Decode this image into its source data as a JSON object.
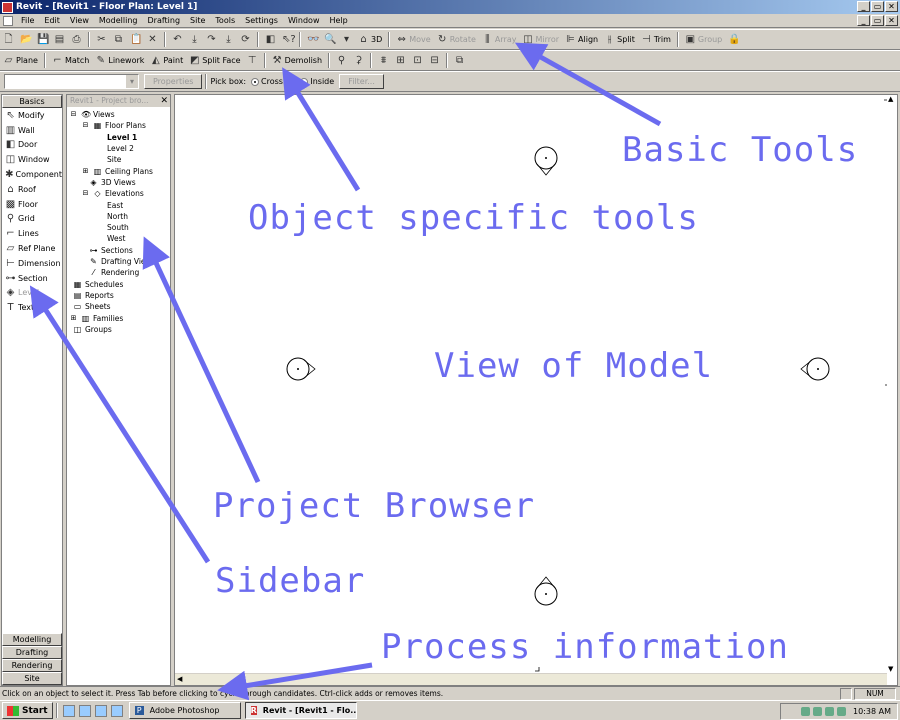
{
  "window": {
    "title": "Revit - [Revit1 - Floor Plan: Level 1]",
    "min": "_",
    "max": "▭",
    "close": "✕"
  },
  "menu": [
    "File",
    "Edit",
    "View",
    "Modelling",
    "Drafting",
    "Site",
    "Tools",
    "Settings",
    "Window",
    "Help"
  ],
  "toolbar1": {
    "view_3d": "3D",
    "basic_tools": [
      {
        "label": "Move",
        "disabled": true
      },
      {
        "label": "Rotate",
        "disabled": true
      },
      {
        "label": "Array",
        "disabled": true
      },
      {
        "label": "Mirror",
        "disabled": true
      },
      {
        "label": "Align",
        "disabled": false
      },
      {
        "label": "Split",
        "disabled": false
      },
      {
        "label": "Trim",
        "disabled": false
      },
      {
        "label": "Group",
        "disabled": true
      }
    ]
  },
  "toolbar2": [
    "Plane",
    "Match",
    "Linework",
    "Paint",
    "Split Face",
    "Demolish"
  ],
  "options_bar": {
    "properties": "Properties",
    "pick_box": "Pick box:",
    "crossing": "Crossing",
    "inside": "Inside",
    "filter": "Filter..."
  },
  "sidebar": {
    "tab": "Basics",
    "items": [
      {
        "label": "Modify",
        "icon": "cursor-icon",
        "glyph": "⇖",
        "disabled": false
      },
      {
        "label": "Wall",
        "icon": "wall-icon",
        "glyph": "▥",
        "disabled": false
      },
      {
        "label": "Door",
        "icon": "door-icon",
        "glyph": "◧",
        "disabled": false
      },
      {
        "label": "Window",
        "icon": "window-icon",
        "glyph": "◫",
        "disabled": false
      },
      {
        "label": "Component",
        "icon": "component-icon",
        "glyph": "✱",
        "disabled": false
      },
      {
        "label": "Roof",
        "icon": "roof-icon",
        "glyph": "⌂",
        "disabled": false
      },
      {
        "label": "Floor",
        "icon": "floor-icon",
        "glyph": "▩",
        "disabled": false
      },
      {
        "label": "Grid",
        "icon": "grid-icon",
        "glyph": "⚲",
        "disabled": false
      },
      {
        "label": "Lines",
        "icon": "lines-icon",
        "glyph": "⌐",
        "disabled": false
      },
      {
        "label": "Ref Plane",
        "icon": "ref-plane-icon",
        "glyph": "▱",
        "disabled": false
      },
      {
        "label": "Dimension",
        "icon": "dimension-icon",
        "glyph": "⊢",
        "disabled": false
      },
      {
        "label": "Section",
        "icon": "section-icon",
        "glyph": "⊶",
        "disabled": false
      },
      {
        "label": "Level",
        "icon": "level-icon",
        "glyph": "◈",
        "disabled": true
      },
      {
        "label": "Text",
        "icon": "text-icon",
        "glyph": "T",
        "disabled": false
      }
    ],
    "bottom_tabs": [
      "Modelling",
      "Drafting",
      "Rendering",
      "Site"
    ]
  },
  "browser": {
    "title": "Revit1 - Project bro...",
    "close": "✕",
    "tree": [
      {
        "label": "Views",
        "icon": "views-icon",
        "glyph": "👁",
        "expander": "⊟"
      },
      {
        "label": "Floor Plans",
        "icon": "floor-plan-icon",
        "glyph": "▦",
        "expander": "⊟"
      },
      {
        "label": "Level 1",
        "bold": true
      },
      {
        "label": "Level 2"
      },
      {
        "label": "Site"
      },
      {
        "label": "Ceiling Plans",
        "icon": "ceiling-plan-icon",
        "glyph": "▥",
        "expander": "⊞"
      },
      {
        "label": "3D Views",
        "icon": "3d-view-icon",
        "glyph": "◈"
      },
      {
        "label": "Elevations",
        "icon": "elevation-icon",
        "glyph": "◇",
        "expander": "⊟"
      },
      {
        "label": "East"
      },
      {
        "label": "North"
      },
      {
        "label": "South"
      },
      {
        "label": "West"
      },
      {
        "label": "Sections",
        "icon": "sections-icon",
        "glyph": "⊶"
      },
      {
        "label": "Drafting Views",
        "icon": "drafting-icon",
        "glyph": "✎"
      },
      {
        "label": "Rendering",
        "icon": "rendering-icon",
        "glyph": "⁄"
      },
      {
        "label": "Schedules",
        "icon": "schedule-icon",
        "glyph": "▦"
      },
      {
        "label": "Reports",
        "icon": "report-icon",
        "glyph": "▤"
      },
      {
        "label": "Sheets",
        "icon": "sheet-icon",
        "glyph": "▭"
      },
      {
        "label": "Families",
        "icon": "families-icon",
        "glyph": "▥",
        "expander": "⊞"
      },
      {
        "label": "Groups",
        "icon": "groups-icon",
        "glyph": "◫"
      }
    ]
  },
  "status": {
    "message": "Click on an object to select it. Press Tab before clicking to cycle through candidates. Ctrl-click adds or removes items.",
    "num": "NUM"
  },
  "taskbar": {
    "start": "Start",
    "tasks": [
      {
        "label": "Adobe Photoshop",
        "active": false
      },
      {
        "label": "Revit - [Revit1 - Flo...",
        "active": true
      }
    ],
    "clock": "10:38 AM"
  },
  "annotations": [
    {
      "id": "basic-tools",
      "text": "Basic Tools"
    },
    {
      "id": "object-specific",
      "text": "Object specific tools"
    },
    {
      "id": "view-model",
      "text": "View of Model"
    },
    {
      "id": "project-browser",
      "text": "Project Browser"
    },
    {
      "id": "sidebar",
      "text": "Sidebar"
    },
    {
      "id": "process-info",
      "text": "Process information"
    }
  ],
  "colors": {
    "annotation": "#6b6bef",
    "title_start": "#0a246a",
    "title_end": "#a6caf0"
  }
}
